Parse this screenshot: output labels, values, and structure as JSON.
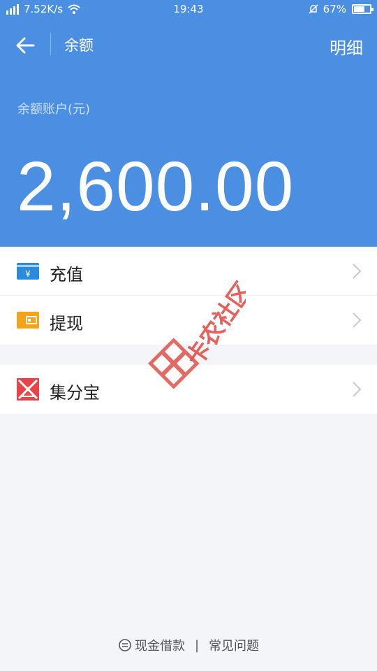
{
  "status_bar": {
    "signal": "4G",
    "net_speed": "7.52K/s",
    "time": "19:43",
    "battery_pct": "67%",
    "battery_level": 0.67
  },
  "nav": {
    "title": "余额",
    "detail_label": "明细"
  },
  "balance": {
    "label": "余额账户(元)",
    "amount": "2,600.00"
  },
  "menu": {
    "items": [
      {
        "label": "充值",
        "icon": "recharge-card-icon"
      },
      {
        "label": "提现",
        "icon": "wallet-icon"
      }
    ],
    "items2": [
      {
        "label": "集分宝",
        "icon": "jifenbao-icon"
      }
    ]
  },
  "footer": {
    "loan_label": "现金借款",
    "separator": "|",
    "faq_label": "常见问题"
  },
  "watermark": {
    "text": "卡农社区"
  },
  "colors": {
    "primary_blue": "#4a8fe2",
    "recharge_blue": "#2a8bdb",
    "wallet_orange": "#f5a31a",
    "jifenbao_red": "#e8434a"
  }
}
